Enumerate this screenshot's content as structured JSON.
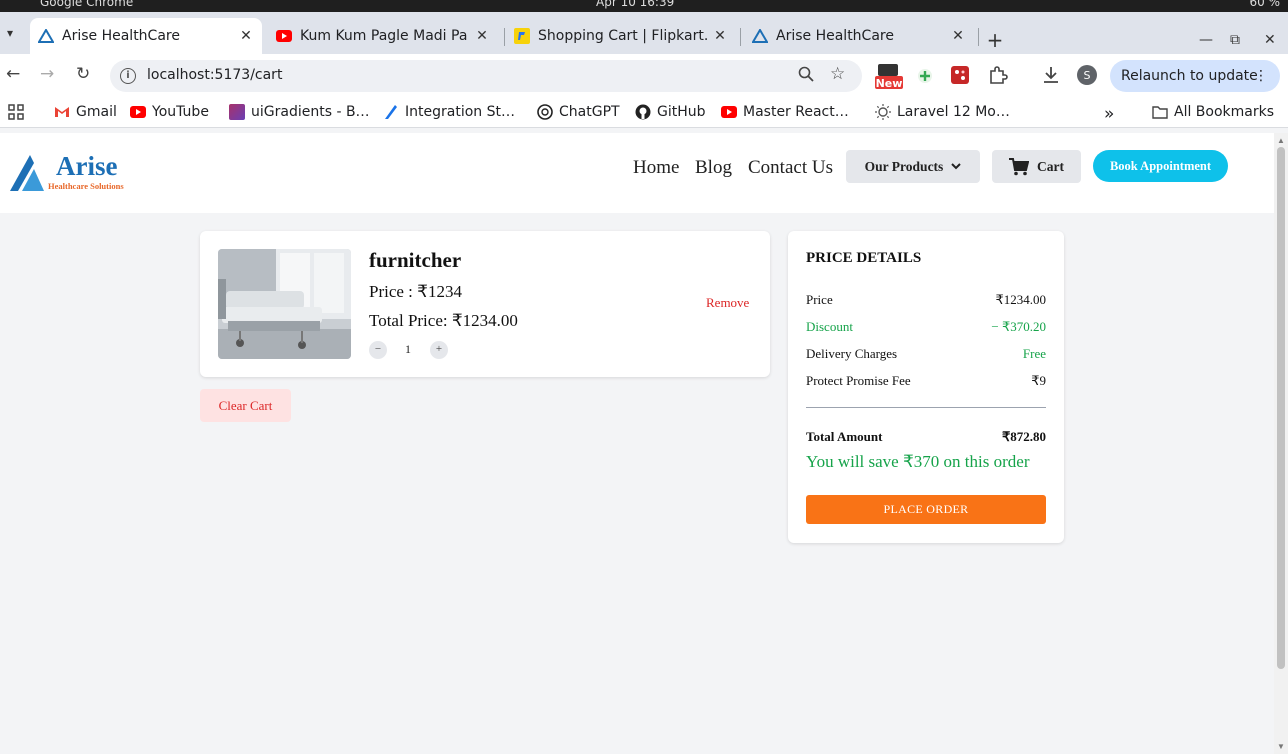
{
  "os": {
    "app_name": "Google Chrome",
    "clock": "Apr 10  16:39",
    "battery": "60 %"
  },
  "tabs": [
    {
      "title": "Arise HealthCare",
      "active": true
    },
    {
      "title": "Kum Kum Pagle Madi Pa",
      "active": false
    },
    {
      "title": "Shopping Cart | Flipkart.",
      "active": false
    },
    {
      "title": "Arise HealthCare",
      "active": false
    }
  ],
  "toolbar": {
    "url": "localhost:5173/cart",
    "relaunch_label": "Relaunch to update",
    "new_badge": "New",
    "profile_initial": "S"
  },
  "bookmarks": [
    {
      "label": "Gmail",
      "icon": "gmail-icon"
    },
    {
      "label": "YouTube",
      "icon": "youtube-icon"
    },
    {
      "label": "uiGradients - B…",
      "icon": "uigradients-icon"
    },
    {
      "label": "Integration St…",
      "icon": "integration-icon"
    },
    {
      "label": "ChatGPT",
      "icon": "chatgpt-icon"
    },
    {
      "label": "GitHub",
      "icon": "github-icon"
    },
    {
      "label": "Master React…",
      "icon": "youtube-icon"
    },
    {
      "label": "Laravel 12 Mo…",
      "icon": "lightbulb-icon"
    }
  ],
  "all_bookmarks": "All Bookmarks",
  "site": {
    "brand": "Arise",
    "tagline": "Healthcare Solutions",
    "nav": {
      "home": "Home",
      "blog": "Blog",
      "contact": "Contact Us",
      "products": "Our Products",
      "cart": "Cart",
      "book": "Book Appointment"
    }
  },
  "cart": {
    "item": {
      "name": "furnitcher",
      "price": "Price : ₹1234",
      "total": "Total Price: ₹1234.00",
      "quantity": "1",
      "remove": "Remove"
    },
    "clear": "Clear Cart"
  },
  "price_details": {
    "title": "PRICE DETAILS",
    "rows": [
      {
        "label": "Price",
        "value": "₹1234.00"
      },
      {
        "label": "Discount",
        "value": "− ₹370.20"
      },
      {
        "label": "Delivery Charges",
        "value": "Free"
      },
      {
        "label": "Protect Promise Fee",
        "value": "₹9"
      }
    ],
    "total_label": "Total Amount",
    "total_value": "₹872.80",
    "savings": "You will save ₹370 on this order",
    "place_order": "PLACE ORDER"
  },
  "colors": {
    "accent_blue": "#0ec1ea",
    "place_order": "#f97316",
    "discount_green": "#16a34a",
    "danger_red": "#dc2626"
  }
}
